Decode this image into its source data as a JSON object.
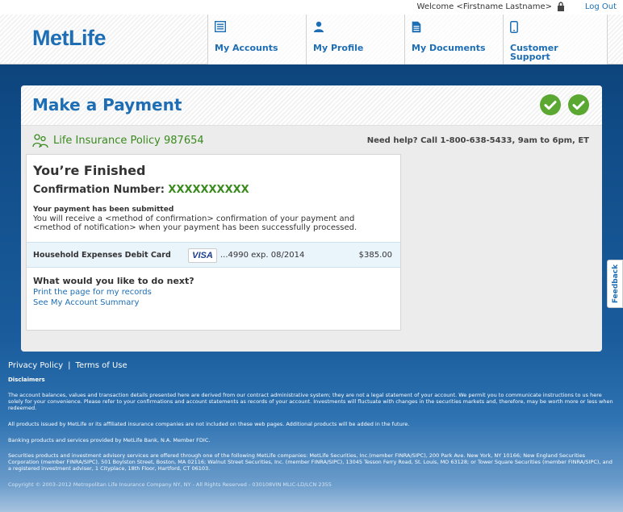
{
  "topbar": {
    "welcome": "Welcome <Firstname Lastname>",
    "logout": "Log Out"
  },
  "header": {
    "logo": "MetLife",
    "nav": [
      {
        "label": "My Accounts",
        "icon": "list-icon"
      },
      {
        "label": "My Profile",
        "icon": "person-icon"
      },
      {
        "label": "My Documents",
        "icon": "document-icon"
      },
      {
        "label": "Customer Support",
        "icon": "phone-icon"
      }
    ]
  },
  "page": {
    "title": "Make a Payment",
    "steps_completed": 2,
    "policy": "Life Insurance Policy 987654",
    "help": "Need help? Call 1-800-638-5433, 9am to 6pm, ET"
  },
  "confirmation": {
    "heading": "You’re Finished",
    "number_label": "Confirmation Number: ",
    "number": "XXXXXXXXXX",
    "submitted_title": "Your payment has been submitted",
    "message": "You will receive a <method of confirmation> confirmation of your payment and <method of notification> when your payment has been successfully processed."
  },
  "payment": {
    "account": "Household Expenses Debit Card",
    "card_brand": "VISA",
    "card_detail": "...4990   exp. 08/2014",
    "amount": "$385.00"
  },
  "next": {
    "question": "What would you like to do next?",
    "link_print": "Print the page for my records",
    "link_summary": "See My Account Summary"
  },
  "feedback": "Feedback",
  "footer": {
    "privacy": "Privacy Policy",
    "separator": "|",
    "terms": "Terms of Use",
    "disclaimers": "Disclaimers",
    "d1": "The account balances, values and transaction details presented here are derived from our contract administrative system; they are not a legal statement of your account. We permit you to communicate instructions to us here solely for your convenience. Please refer to your confirmations and account statements as records of your account. Investments will fluctuate with changes in the securities markets and, therefore, may be worth more or less when redeemed.",
    "d2": "All products issued by MetLife or its affiliated insurance companies are not included on these web pages. Additional products will be added in the future.",
    "d3": "Banking products and services provided by MetLife Bank, N.A. Member FDIC.",
    "d4": "Securities products and investment advisory services are offered through one of the following MetLife companies: MetLife Securities, Inc.(member FINRA/SIPC), 200 Park Ave. New York, NY 10166; New England Securities Corporation (member FINRA/SIPC), 501 Boylston Street, Boston, MA 02116; Walnut Street Securities, Inc. (member FINRA/SIPC), 13045 Tesson Ferry Road, St. Louis, MO 63128; or Tower Square Securities (member FINRA/SIPC), and a registered investment adviser, 1 Cityplace, 18th Floor, Hartford, CT 06103.",
    "copyright": "Copyright © 2003–2012 Metropolitan Life Insurance Company NY, NY - All Rights Reserved - 030108VIN MLIC-LD/LCN 2355"
  },
  "colors": {
    "brand_blue": "#1d6eb5",
    "success_green": "#3a8a1e",
    "check_green": "#5aa832"
  }
}
